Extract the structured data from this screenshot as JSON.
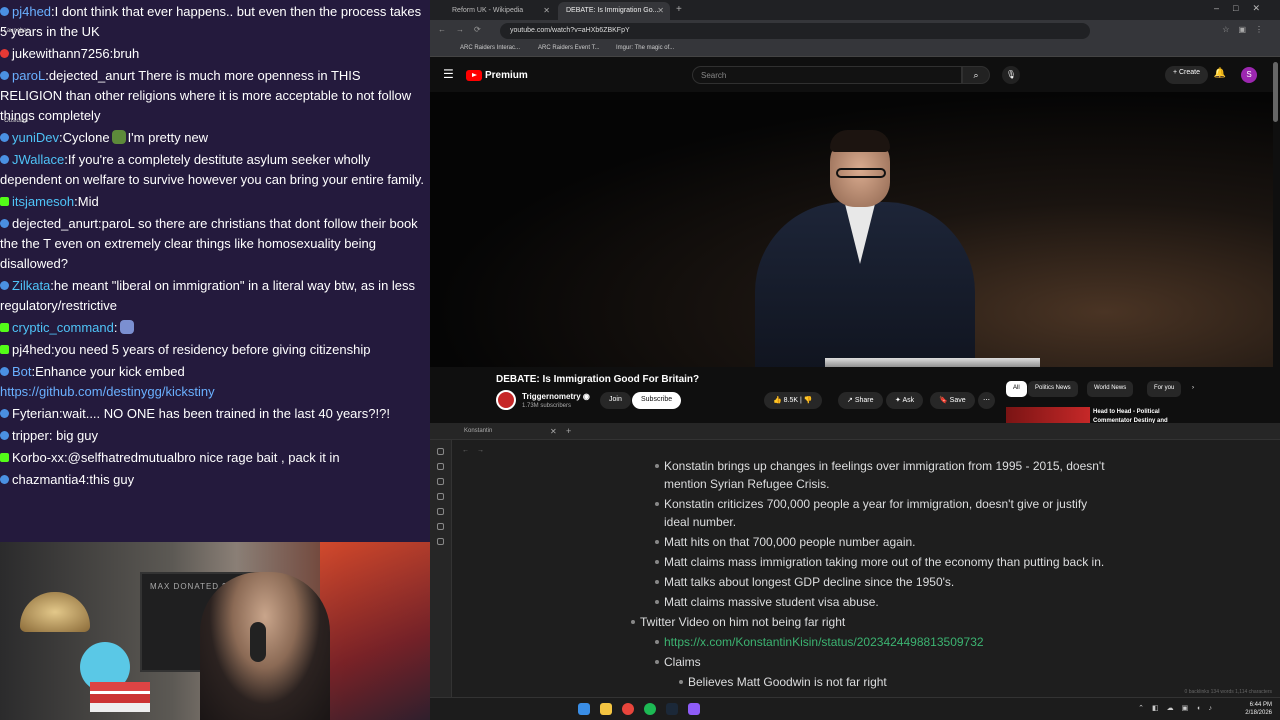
{
  "chat": {
    "messages": [
      {
        "user": "pj4hed",
        "color": "#6ab0ff",
        "badge": "#4a90e2",
        "text": "I dont think that ever happens.. but even then the process takes 5 years in the UK"
      },
      {
        "user": "jukewithann7256",
        "color": "#ffffff",
        "badge": "#e53935",
        "text": "bruh"
      },
      {
        "user": "paroL",
        "color": "#6ab0ff",
        "badge": "#4a90e2",
        "text": "dejected_anurt There is much more openness in THIS RELIGION than other religions where it is more acceptable to not follow things completely"
      },
      {
        "user": "yuniDev",
        "color": "#4fc3f7",
        "badge": "#4a90e2",
        "text": "Cyclone",
        "emote": "#5d8a3a",
        "text2": "I'm pretty new"
      },
      {
        "user": "JWallace",
        "color": "#4fc3f7",
        "badge": "#4a90e2",
        "text": "If you're a completely destitute asylum seeker wholly dependent on welfare to survive however you can bring your entire family."
      },
      {
        "user": "itsjamesoh",
        "color": "#4fc3f7",
        "badge": "#53fc18",
        "badgeShape": "sq",
        "text": "Mid"
      },
      {
        "user": "dejected_anurt",
        "color": "#ffffff",
        "badge": "#4a90e2",
        "text": "paroL so there are christians that dont follow their book the the T even on extremely clear things like homosexuality being disallowed?"
      },
      {
        "user": "Zilkata",
        "color": "#4fc3f7",
        "badge": "#4a90e2",
        "text": "he meant \"liberal on immigration\" in a literal way btw, as in less regulatory/restrictive"
      },
      {
        "user": "cryptic_command",
        "color": "#4fc3f7",
        "badge": "#53fc18",
        "badgeShape": "sq",
        "text": "",
        "emote": "#7b8fd1"
      },
      {
        "user": "pj4hed",
        "color": "#ffffff",
        "badge": "#53fc18",
        "badgeShape": "sq",
        "text": "you need 5 years of residency before giving citizenship"
      },
      {
        "user": "Bot",
        "color": "#6ab0ff",
        "badge": "#4a90e2",
        "text": "Enhance your kick embed",
        "link": "https://github.com/destinygg/kickstiny"
      },
      {
        "user": "Fyterian",
        "color": "#ffffff",
        "badge": "#4a90e2",
        "text": "wait.... NO ONE has been trained in the last 40 years?!?!"
      },
      {
        "user": "tripper",
        "color": "#ffffff",
        "badge": "#4a90e2",
        "text": " big guy"
      },
      {
        "user": "Korbo-xx",
        "color": "#ffffff",
        "badge": "#53fc18",
        "badgeShape": "sq",
        "text": "@selfhatredmutualbro nice rage bait , pack it in"
      },
      {
        "user": "chazmantia4",
        "color": "#ffffff",
        "badge": "#4a90e2",
        "text": "this guy"
      }
    ],
    "side_labels": [
      "Launcher",
      "Obsidian"
    ]
  },
  "webcam": {
    "shelf_label": "MAX DONATED $10.00"
  },
  "browser": {
    "tabs": [
      {
        "label": "Reform UK - Wikipedia"
      },
      {
        "label": "DEBATE: Is Immigration Go..."
      }
    ],
    "url": "youtube.com/watch?v=aHXb6ZBKFpY",
    "bookmarks": [
      "ARC Raiders Interac...",
      "ARC Raiders Event T...",
      "Imgur: The magic of..."
    ]
  },
  "youtube": {
    "logo": "Premium",
    "search_placeholder": "Search",
    "create_label": "Create",
    "avatar_letter": "S",
    "video_title": "DEBATE: Is Immigration Good For Britain?",
    "channel": "Triggernometry",
    "subscribers": "1.73M subscribers",
    "join": "Join",
    "subscribe": "Subscribe",
    "likes": "8.5K",
    "share": "Share",
    "ask": "Ask",
    "save": "Save",
    "chips": [
      "All",
      "Politics News",
      "World News",
      "For you"
    ],
    "rec_title": "Head to Head - Political Commentator Destiny and"
  },
  "obsidian": {
    "tab": "Konstantin",
    "notes": [
      {
        "level": 2,
        "text": "Konstatin brings up changes in feelings over immigration from 1995 - 2015, doesn't mention Syrian Refugee Crisis."
      },
      {
        "level": 2,
        "text": "Konstatin criticizes 700,000 people a year for immigration, doesn't give or justify ideal number."
      },
      {
        "level": 2,
        "text": "Matt hits on that 700,000 people number again."
      },
      {
        "level": 2,
        "text": "Matt claims mass immigration taking more out of the economy than putting back in."
      },
      {
        "level": 2,
        "text": "Matt talks about longest GDP decline since the 1950's."
      },
      {
        "level": 2,
        "text": "Matt claims massive student visa abuse."
      },
      {
        "level": 1,
        "text": "Twitter Video on him not being far right"
      },
      {
        "level": 2,
        "link": "https://x.com/KonstantinKisin/status/2023424498813509732"
      },
      {
        "level": 2,
        "text": "Claims"
      },
      {
        "level": 3,
        "text": "Believes Matt Goodwin is not far right"
      }
    ],
    "status": "0 backlinks   134 words   1,114 characters"
  },
  "taskbar": {
    "time": "6:44 PM",
    "date": "2/18/2026"
  }
}
